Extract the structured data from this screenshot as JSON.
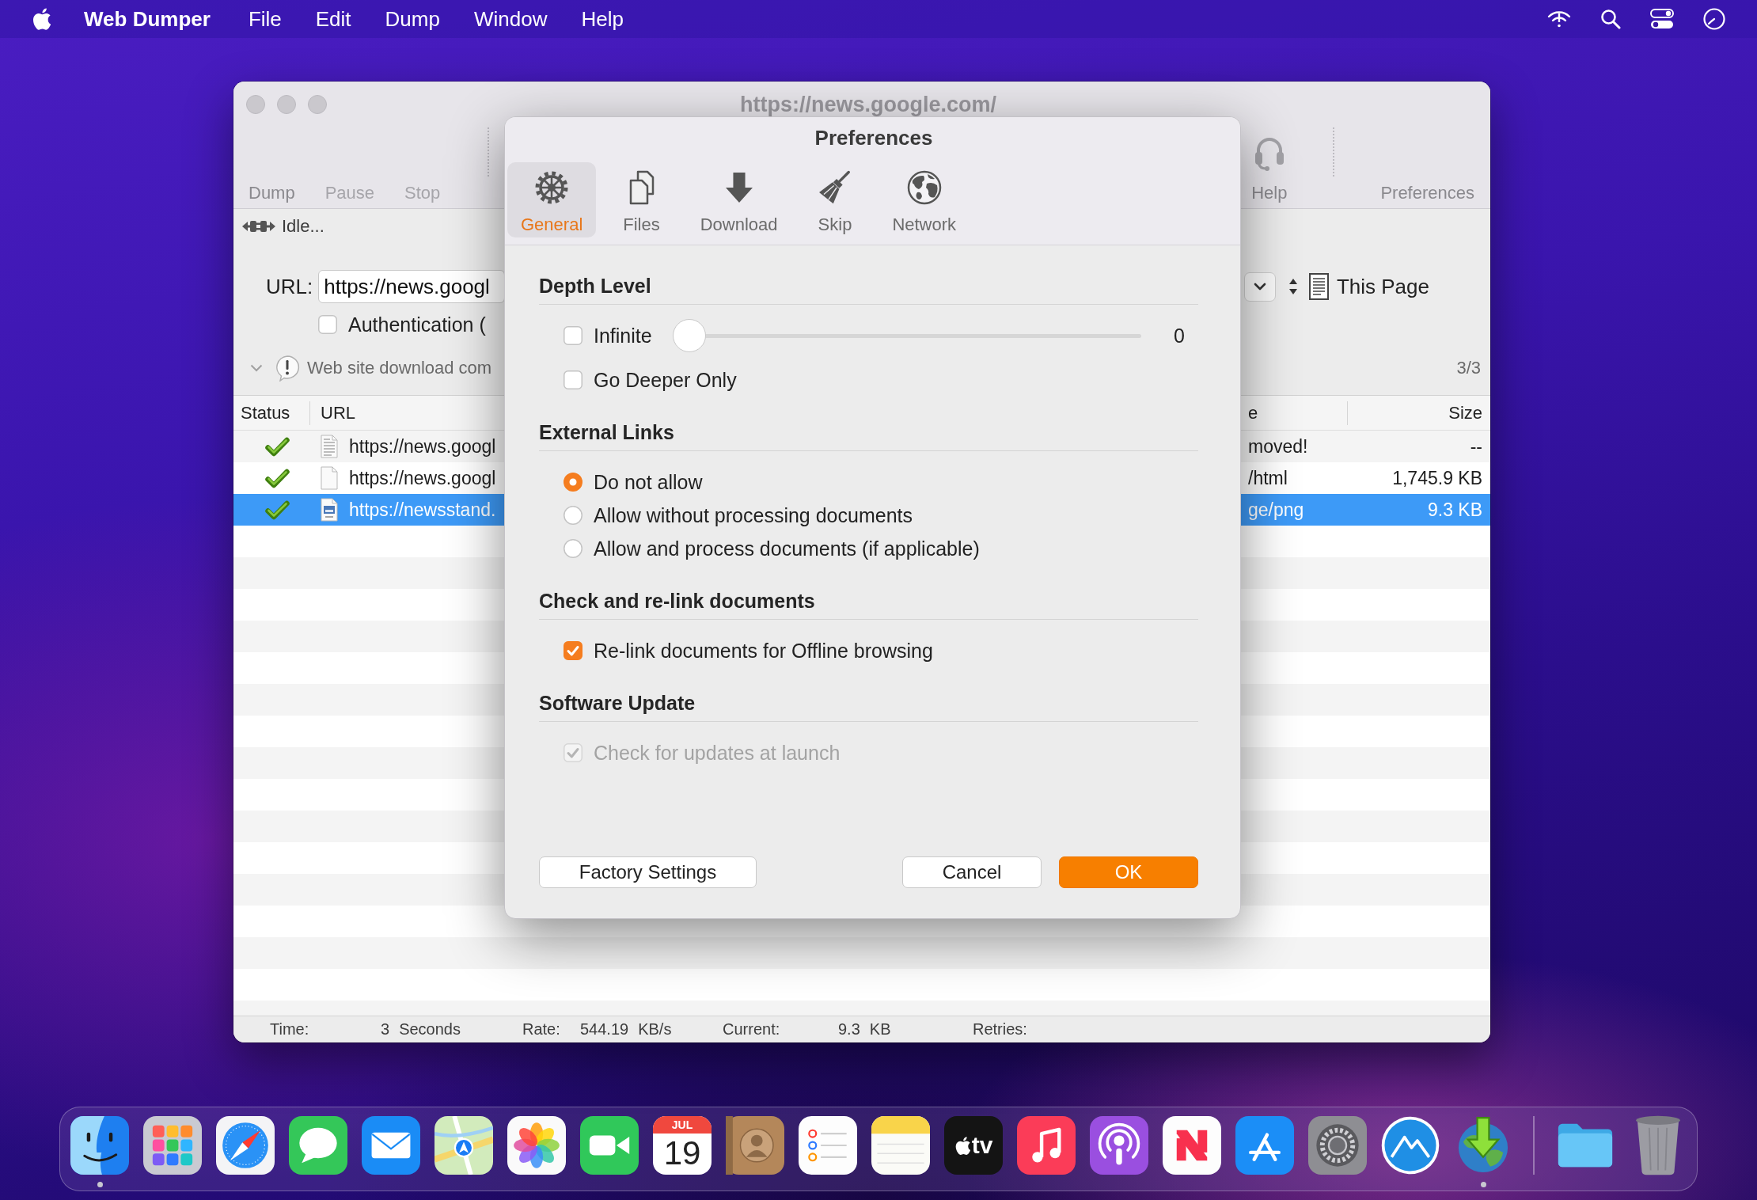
{
  "menu_bar": {
    "app_name": "Web Dumper",
    "items": [
      "File",
      "Edit",
      "Dump",
      "Window",
      "Help"
    ]
  },
  "main_window": {
    "title": "https://news.google.com/",
    "toolbar": {
      "left": [
        {
          "label": "Dump",
          "disabled": false
        },
        {
          "label": "Pause",
          "disabled": true
        },
        {
          "label": "Stop",
          "disabled": true
        }
      ],
      "right": [
        {
          "kind": "icon",
          "label": "Help",
          "disabled": false
        },
        {
          "kind": "text",
          "label": "Preferences",
          "disabled": false
        }
      ]
    },
    "connection": {
      "status": "Idle..."
    },
    "url": {
      "label": "URL:",
      "value": "https://news.googl"
    },
    "authentication": {
      "label": "Authentication (",
      "checked": false
    },
    "scope": {
      "label": "This Page"
    },
    "log": {
      "message": "Web site download com",
      "count": "3/3"
    },
    "table": {
      "columns": [
        "Status",
        "URL",
        "e",
        "Size"
      ],
      "rows": [
        {
          "done": true,
          "kind": "text",
          "url": "https://news.googl",
          "type": "moved!",
          "size": "--",
          "selected": false
        },
        {
          "done": true,
          "kind": "blank",
          "url": "https://news.googl",
          "type": "/html",
          "size": "1,745.9 KB",
          "selected": false
        },
        {
          "done": true,
          "kind": "image",
          "url": "https://newsstand.",
          "type": "ge/png",
          "size": "9.3 KB",
          "selected": true
        }
      ]
    },
    "status_bar": [
      {
        "label": "Time:",
        "value": "3",
        "unit": "Seconds"
      },
      {
        "label": "Rate:",
        "value": "544.19",
        "unit": "KB/s"
      },
      {
        "label": "Current:",
        "value": "9.3",
        "unit": "KB"
      },
      {
        "label": "Retries:"
      }
    ]
  },
  "preferences": {
    "title": "Preferences",
    "tabs": [
      {
        "label": "General",
        "selected": true
      },
      {
        "label": "Files",
        "selected": false
      },
      {
        "label": "Download",
        "selected": false
      },
      {
        "label": "Skip",
        "selected": false
      },
      {
        "label": "Network",
        "selected": false
      }
    ],
    "sections": [
      {
        "title": "Depth Level",
        "rows": [
          {
            "kind": "slider",
            "label": "Infinite",
            "checked": false,
            "disabled": false,
            "level": 0,
            "reading": "0"
          },
          {
            "kind": "checkbox",
            "label": "Go Deeper Only",
            "checked": false,
            "disabled": false
          }
        ]
      },
      {
        "title": "External Links",
        "rows": [
          {
            "kind": "radio",
            "label": "Do not allow",
            "selected": true,
            "disabled": false
          },
          {
            "kind": "radio",
            "label": "Allow without processing documents",
            "selected": false,
            "disabled": false
          },
          {
            "kind": "radio",
            "label": "Allow and process documents (if applicable)",
            "selected": false,
            "disabled": false
          }
        ]
      },
      {
        "title": "Check and re-link documents",
        "rows": [
          {
            "kind": "checkbox",
            "label": "Re-link documents for Offline browsing",
            "checked": true,
            "disabled": false
          }
        ]
      },
      {
        "title": "Software Update",
        "rows": [
          {
            "kind": "checkbox",
            "label": "Check for updates at launch",
            "checked": true,
            "disabled": true
          }
        ]
      }
    ],
    "buttons": [
      {
        "label": "Factory Settings",
        "kind": "normal"
      },
      {
        "label": "Cancel",
        "kind": "normal"
      },
      {
        "label": "OK",
        "kind": "default"
      }
    ]
  },
  "dock": {
    "apps": [
      {
        "running": true
      },
      {
        "running": false
      },
      {
        "running": false
      },
      {
        "running": false
      },
      {
        "running": false
      },
      {
        "running": false
      },
      {
        "running": false
      },
      {
        "running": false
      },
      {
        "running": false,
        "month": "JUL",
        "day": "19"
      },
      {
        "running": false
      },
      {
        "running": false
      },
      {
        "running": false
      },
      {
        "running": false,
        "label": "tv"
      },
      {
        "running": false
      },
      {
        "running": false
      },
      {
        "running": false
      },
      {
        "running": false
      },
      {
        "running": false
      },
      {
        "running": false
      },
      {
        "running": true
      }
    ],
    "others": [
      {
        "running": false
      },
      {
        "running": false
      }
    ]
  }
}
